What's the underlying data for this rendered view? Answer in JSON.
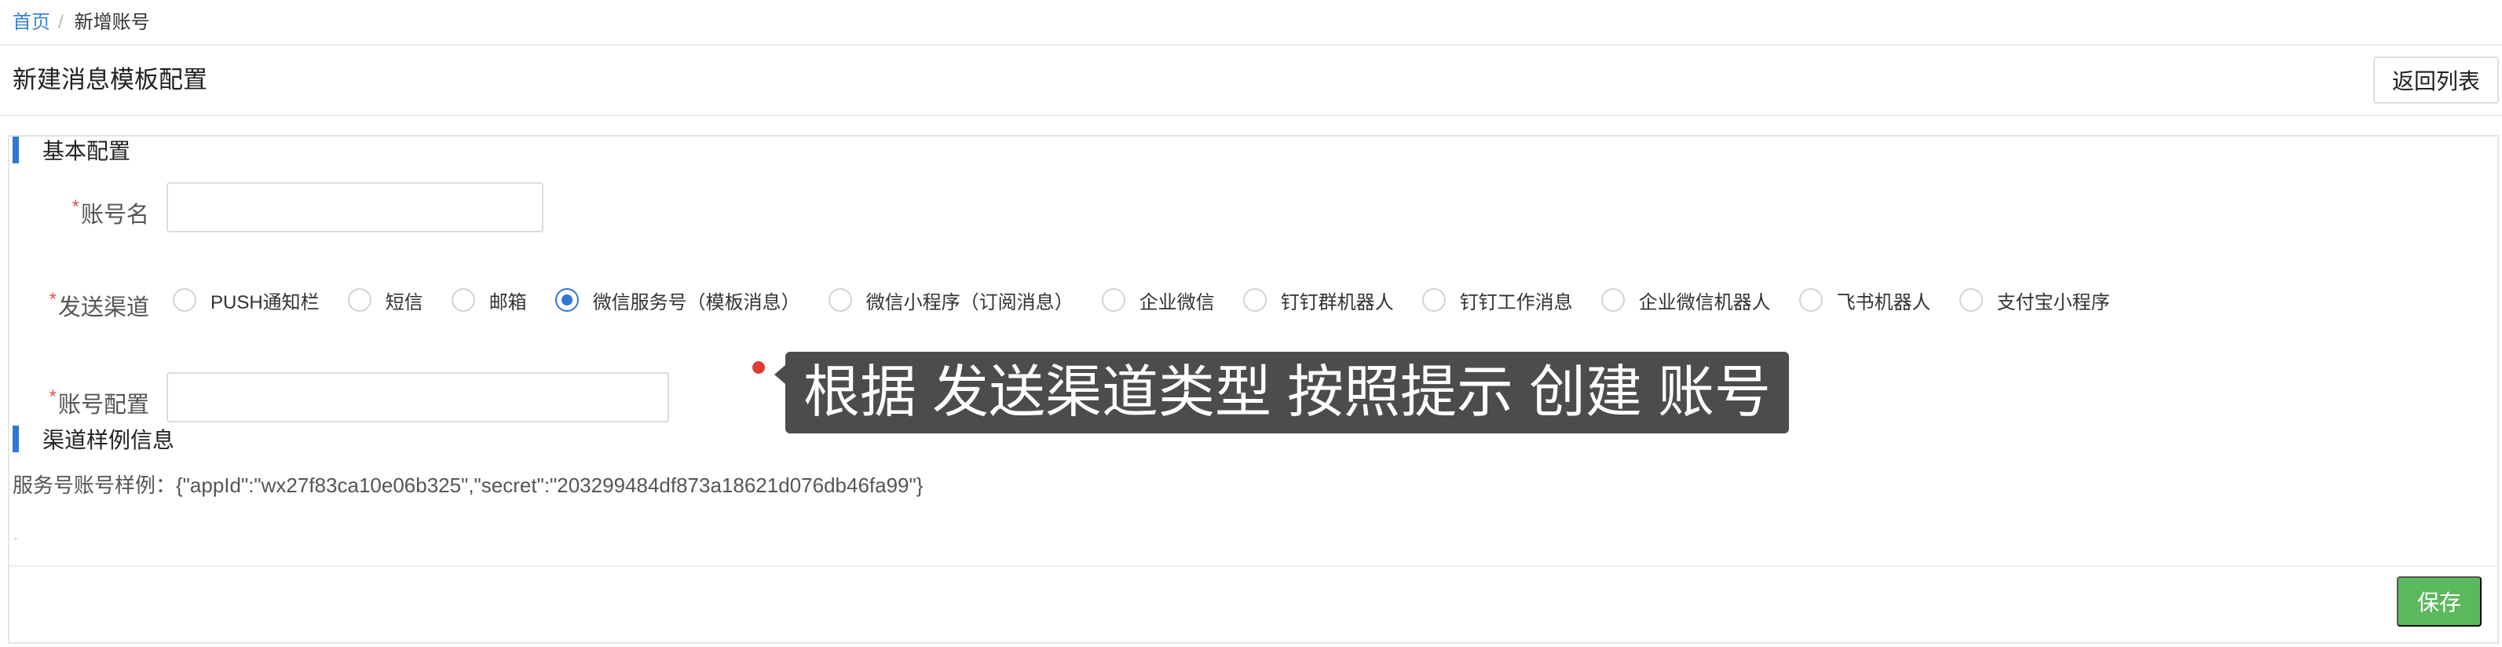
{
  "breadcrumb": {
    "home": "首页",
    "separator": "/",
    "current": "新增账号"
  },
  "header": {
    "title": "新建消息模板配置",
    "back_button": "返回列表"
  },
  "form": {
    "basic_section_title": "基本配置",
    "required_mark": "*",
    "account_name_label": "账号名",
    "account_name_value": "",
    "channel_label": "发送渠道",
    "channels": [
      "PUSH通知栏",
      "短信",
      "邮箱",
      "微信服务号（模板消息）",
      "微信小程序（订阅消息）",
      "企业微信",
      "钉钉群机器人",
      "钉钉工作消息",
      "企业微信机器人",
      "飞书机器人",
      "支付宝小程序"
    ],
    "selected_channel": "微信服务号（模板消息）",
    "account_config_label": "账号配置",
    "account_config_value": "",
    "sample_section_title": "渠道样例信息",
    "sample_text": "服务号账号样例：{\"appId\":\"wx27f83ca10e06b325\",\"secret\":\"203299484df873a18621d076db46fa99\"}",
    "small_mark": "-",
    "save_button": "保存"
  },
  "tooltip": {
    "text": "根据 发送渠道类型 按照提示 创建 账号"
  },
  "colors": {
    "primary": "#2f78d6",
    "success": "#5cb85c",
    "danger": "#e25555",
    "tooltip_bg": "#424242"
  }
}
